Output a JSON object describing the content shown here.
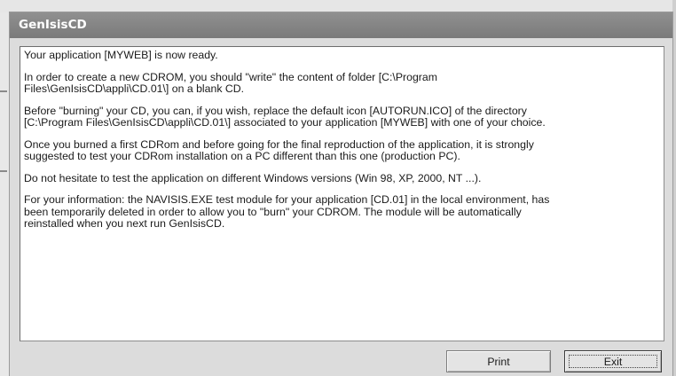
{
  "window": {
    "title": "GenIsisCD"
  },
  "message": {
    "paragraphs": [
      "Your application [MYWEB] is now ready.",
      "In order to create a new CDROM, you should \"write\" the content of folder [C:\\Program\nFiles\\GenIsisCD\\appli\\CD.01\\] on a blank CD.",
      "Before \"burning\" your CD, you can, if you wish, replace the default icon [AUTORUN.ICO] of the directory\n[C:\\Program Files\\GenIsisCD\\appli\\CD.01\\] associated to your application [MYWEB] with one of your choice.",
      "Once you burned a first CDRom and before going for the final reproduction of the application, it is strongly\nsuggested to test your CDRom installation on a PC different than this one (production PC).",
      "Do not hesitate to test the application on different Windows versions (Win 98, XP, 2000, NT ...).",
      "For your information: the NAVISIS.EXE test module for your application [CD.01] in the local environment, has\nbeen temporarily deleted in order to allow you to \"burn\" your CDROM. The module will be automatically\nreinstalled when you next run GenIsisCD."
    ]
  },
  "buttons": {
    "print": "Print",
    "exit": "Exit"
  }
}
